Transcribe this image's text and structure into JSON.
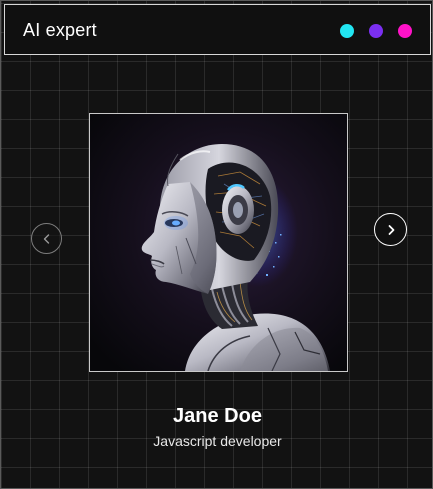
{
  "header": {
    "title": "AI expert",
    "dots": [
      {
        "name": "cyan",
        "color": "#22e6f2"
      },
      {
        "name": "purple",
        "color": "#7b2ff2"
      },
      {
        "name": "magenta",
        "color": "#ff12c8"
      }
    ]
  },
  "carousel": {
    "prev_icon": "chevron-left-icon",
    "next_icon": "chevron-right-icon",
    "image_subject": "robot-woman-portrait"
  },
  "profile": {
    "name": "Jane Doe",
    "role": "Javascript developer"
  }
}
